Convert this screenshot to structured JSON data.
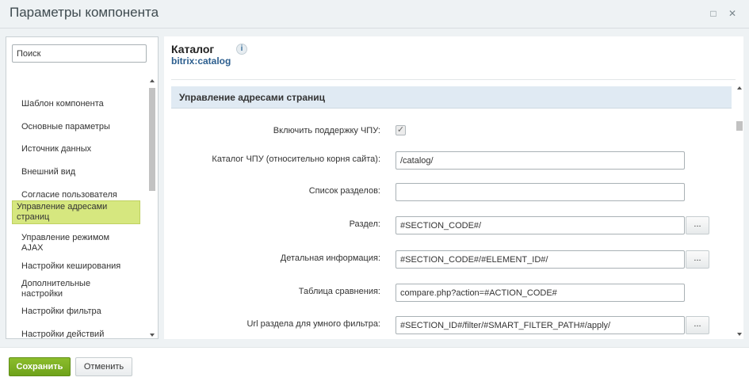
{
  "window": {
    "title": "Параметры компонента",
    "maximize_icon": "□",
    "close_icon": "✕"
  },
  "sidebar": {
    "search_placeholder": "Поиск",
    "items": [
      {
        "label": "Шаблон компонента"
      },
      {
        "label": "Основные параметры"
      },
      {
        "label": "Источник данных"
      },
      {
        "label": "Внешний вид"
      },
      {
        "label": "Согласие пользователя"
      },
      {
        "label": "Управление адресами страниц",
        "active": true
      },
      {
        "label": "Управление режимом AJAX"
      },
      {
        "label": "Настройки кеширования"
      },
      {
        "label": "Дополнительные настройки"
      },
      {
        "label": "Настройки фильтра"
      },
      {
        "label": "Настройки действий"
      }
    ]
  },
  "component": {
    "title": "Каталог",
    "code": "bitrix:catalog",
    "info_icon": "i"
  },
  "section": {
    "title": "Управление адресами страниц"
  },
  "fields": {
    "sef_mode": {
      "label": "Включить поддержку ЧПУ:",
      "checked": true,
      "mark": "✓"
    },
    "sef_folder": {
      "label": "Каталог ЧПУ (относительно корня сайта):",
      "value": "/catalog/"
    },
    "sections": {
      "label": "Список разделов:",
      "value": ""
    },
    "section": {
      "label": "Раздел:",
      "value": "#SECTION_CODE#/",
      "button": "..."
    },
    "detail": {
      "label": "Детальная информация:",
      "value": "#SECTION_CODE#/#ELEMENT_ID#/",
      "button": "..."
    },
    "compare": {
      "label": "Таблица сравнения:",
      "value": "compare.php?action=#ACTION_CODE#"
    },
    "smart_filter": {
      "label": "Url раздела для умного фильтра:",
      "value": "#SECTION_ID#/filter/#SMART_FILTER_PATH#/apply/",
      "button": "..."
    }
  },
  "footer": {
    "save_label": "Сохранить",
    "cancel_label": "Отменить"
  },
  "colors": {
    "active_item": "#d6e77f",
    "save_button": "#7aad22",
    "section_bar": "#e0eaf3"
  }
}
